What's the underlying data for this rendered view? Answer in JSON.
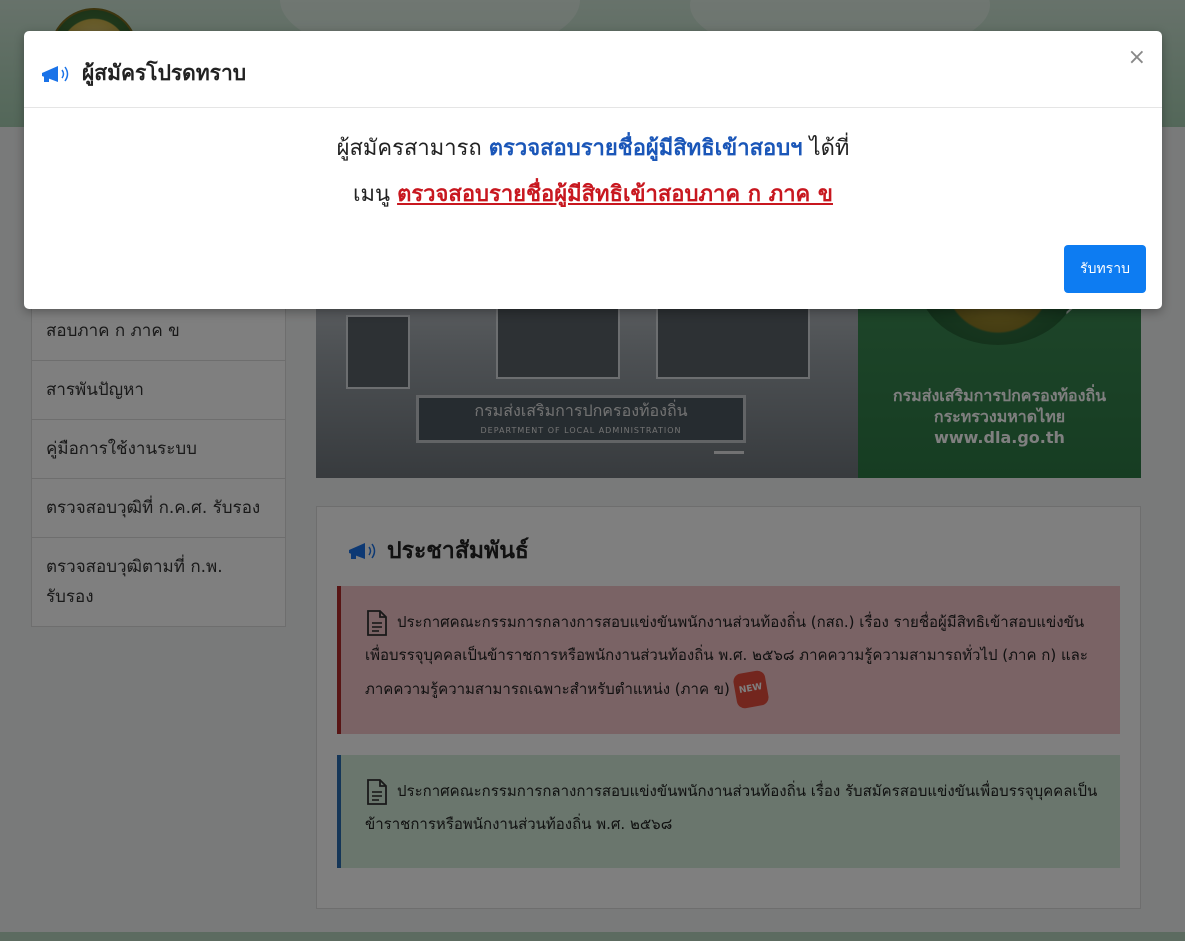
{
  "colors": {
    "accent_blue": "#0d7cf2",
    "link_blue": "#1a56b8",
    "link_red": "#c8171f",
    "announcement_red_bg": "#f5c6cb",
    "announcement_green_bg": "#d4edda",
    "banner_green": "#2d7a45"
  },
  "sidebar": {
    "items": [
      {
        "label": "สอบภาค ก ภาค ข"
      },
      {
        "label": "สารพันปัญหา"
      },
      {
        "label": "คู่มือการใช้งานระบบ"
      },
      {
        "label": "ตรวจสอบวุฒิที่ ก.ค.ศ. รับรอง"
      },
      {
        "label": "ตรวจสอบวุฒิตามที่ ก.พ. รับรอง"
      }
    ]
  },
  "banner": {
    "sign_text": "กรมส่งเสริมการปกครองท้องถิ่น",
    "sign_subtext": "DEPARTMENT OF LOCAL ADMINISTRATION",
    "green_line1": "กรมส่งเสริมการปกครองท้องถิ่น",
    "green_line2": "กระทรวงมหาดไทย",
    "green_line3": "www.dla.go.th",
    "next_arrow": "›"
  },
  "public_relations": {
    "title": "ประชาสัมพันธ์",
    "icon": "megaphone-icon",
    "announcements": [
      {
        "text": "ประกาศคณะกรรมการกลางการสอบแข่งขันพนักงานส่วนท้องถิ่น (กสถ.) เรื่อง รายชื่อผู้มีสิทธิเข้าสอบแข่งขันเพื่อบรรจุบุคคลเป็นข้าราชการหรือพนักงานส่วนท้องถิ่น พ.ศ. ๒๕๖๘ ภาคความรู้ความสามารถทั่วไป (ภาค ก) และภาคความรู้ความสามารถเฉพาะสำหรับตำแหน่ง (ภาค ข)",
        "badge": "NEW"
      },
      {
        "text": "ประกาศคณะกรรมการกลางการสอบแข่งขันพนักงานส่วนท้องถิ่น เรื่อง รับสมัครสอบแข่งขันเพื่อบรรจุบุคคลเป็นข้าราชการหรือพนักงานส่วนท้องถิ่น พ.ศ. ๒๕๖๘"
      }
    ]
  },
  "modal": {
    "title": "ผู้สมัครโปรดทราบ",
    "close_symbol": "×",
    "line1_prefix": "ผู้สมัครสามารถ",
    "line1_link": "ตรวจสอบรายชื่อผู้มีสิทธิเข้าสอบฯ",
    "line1_suffix": "ได้ที่",
    "line2_prefix": "เมนู",
    "line2_link": "ตรวจสอบรายชื่อผู้มีสิทธิเข้าสอบภาค ก ภาค ข",
    "ok_label": "รับทราบ"
  }
}
